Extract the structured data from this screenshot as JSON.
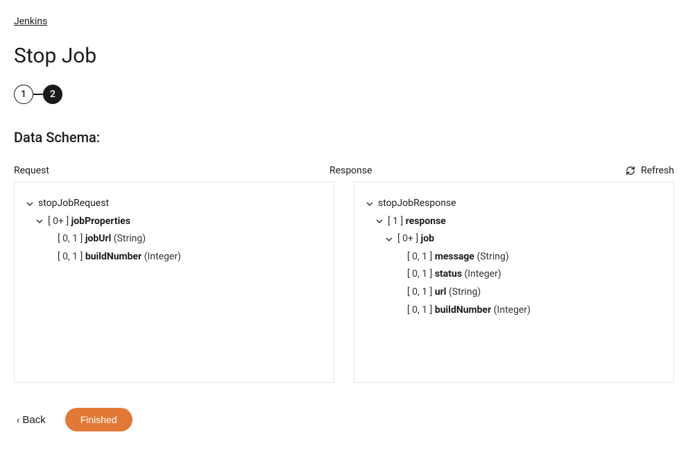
{
  "breadcrumb": {
    "label": "Jenkins"
  },
  "page": {
    "title": "Stop Job"
  },
  "stepper": {
    "step1": "1",
    "step2": "2"
  },
  "section": {
    "title": "Data Schema:"
  },
  "labels": {
    "request": "Request",
    "response": "Response",
    "refresh": "Refresh",
    "back": "Back",
    "finished": "Finished"
  },
  "request": {
    "root": {
      "name": "stopJobRequest"
    },
    "jobProperties": {
      "card": "[ 0+ ]",
      "name": "jobProperties"
    },
    "jobUrl": {
      "card": "[ 0, 1 ]",
      "name": "jobUrl",
      "type": "(String)"
    },
    "buildNumber": {
      "card": "[ 0, 1 ]",
      "name": "buildNumber",
      "type": "(Integer)"
    }
  },
  "response": {
    "root": {
      "name": "stopJobResponse"
    },
    "response": {
      "card": "[ 1 ]",
      "name": "response"
    },
    "job": {
      "card": "[ 0+ ]",
      "name": "job"
    },
    "message": {
      "card": "[ 0, 1 ]",
      "name": "message",
      "type": "(String)"
    },
    "status": {
      "card": "[ 0, 1 ]",
      "name": "status",
      "type": "(Integer)"
    },
    "url": {
      "card": "[ 0, 1 ]",
      "name": "url",
      "type": "(String)"
    },
    "buildNumber": {
      "card": "[ 0, 1 ]",
      "name": "buildNumber",
      "type": "(Integer)"
    }
  }
}
